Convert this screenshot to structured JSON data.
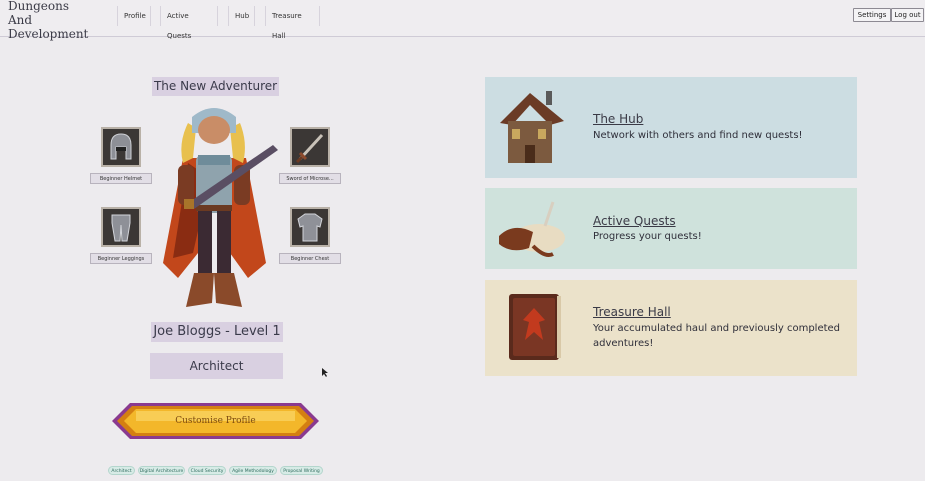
{
  "nav": {
    "brand_line1": "Dungeons",
    "brand_line2": "And Development",
    "links": [
      "Profile",
      "Active Quests",
      "Hub",
      "Treasure Hall"
    ],
    "settings": "Settings",
    "logout": "Log out"
  },
  "character": {
    "title": "The New Adventurer",
    "equipment": {
      "helmet": "Beginner Helmet",
      "sword": "Sword of Microse...",
      "leggings": "Beginner Leggings",
      "chest": "Beginner Chest"
    },
    "name_level": "Joe Bloggs - Level 1",
    "class": "Architect",
    "customise_button": "Customise Profile",
    "skills": [
      "Architect",
      "Digital Architecture",
      "Cloud Security",
      "Agile Methodology",
      "Proposal Writing"
    ]
  },
  "cards": [
    {
      "title": "The Hub",
      "description": "Network with others and find new quests!",
      "bg": "#ccdde2"
    },
    {
      "title": "Active Quests",
      "description": "Progress your quests!",
      "bg": "#cfe2dc"
    },
    {
      "title": "Treasure Hall",
      "description": "Your accumulated haul and previously completed adventures!",
      "bg": "#ebe2ca"
    }
  ]
}
